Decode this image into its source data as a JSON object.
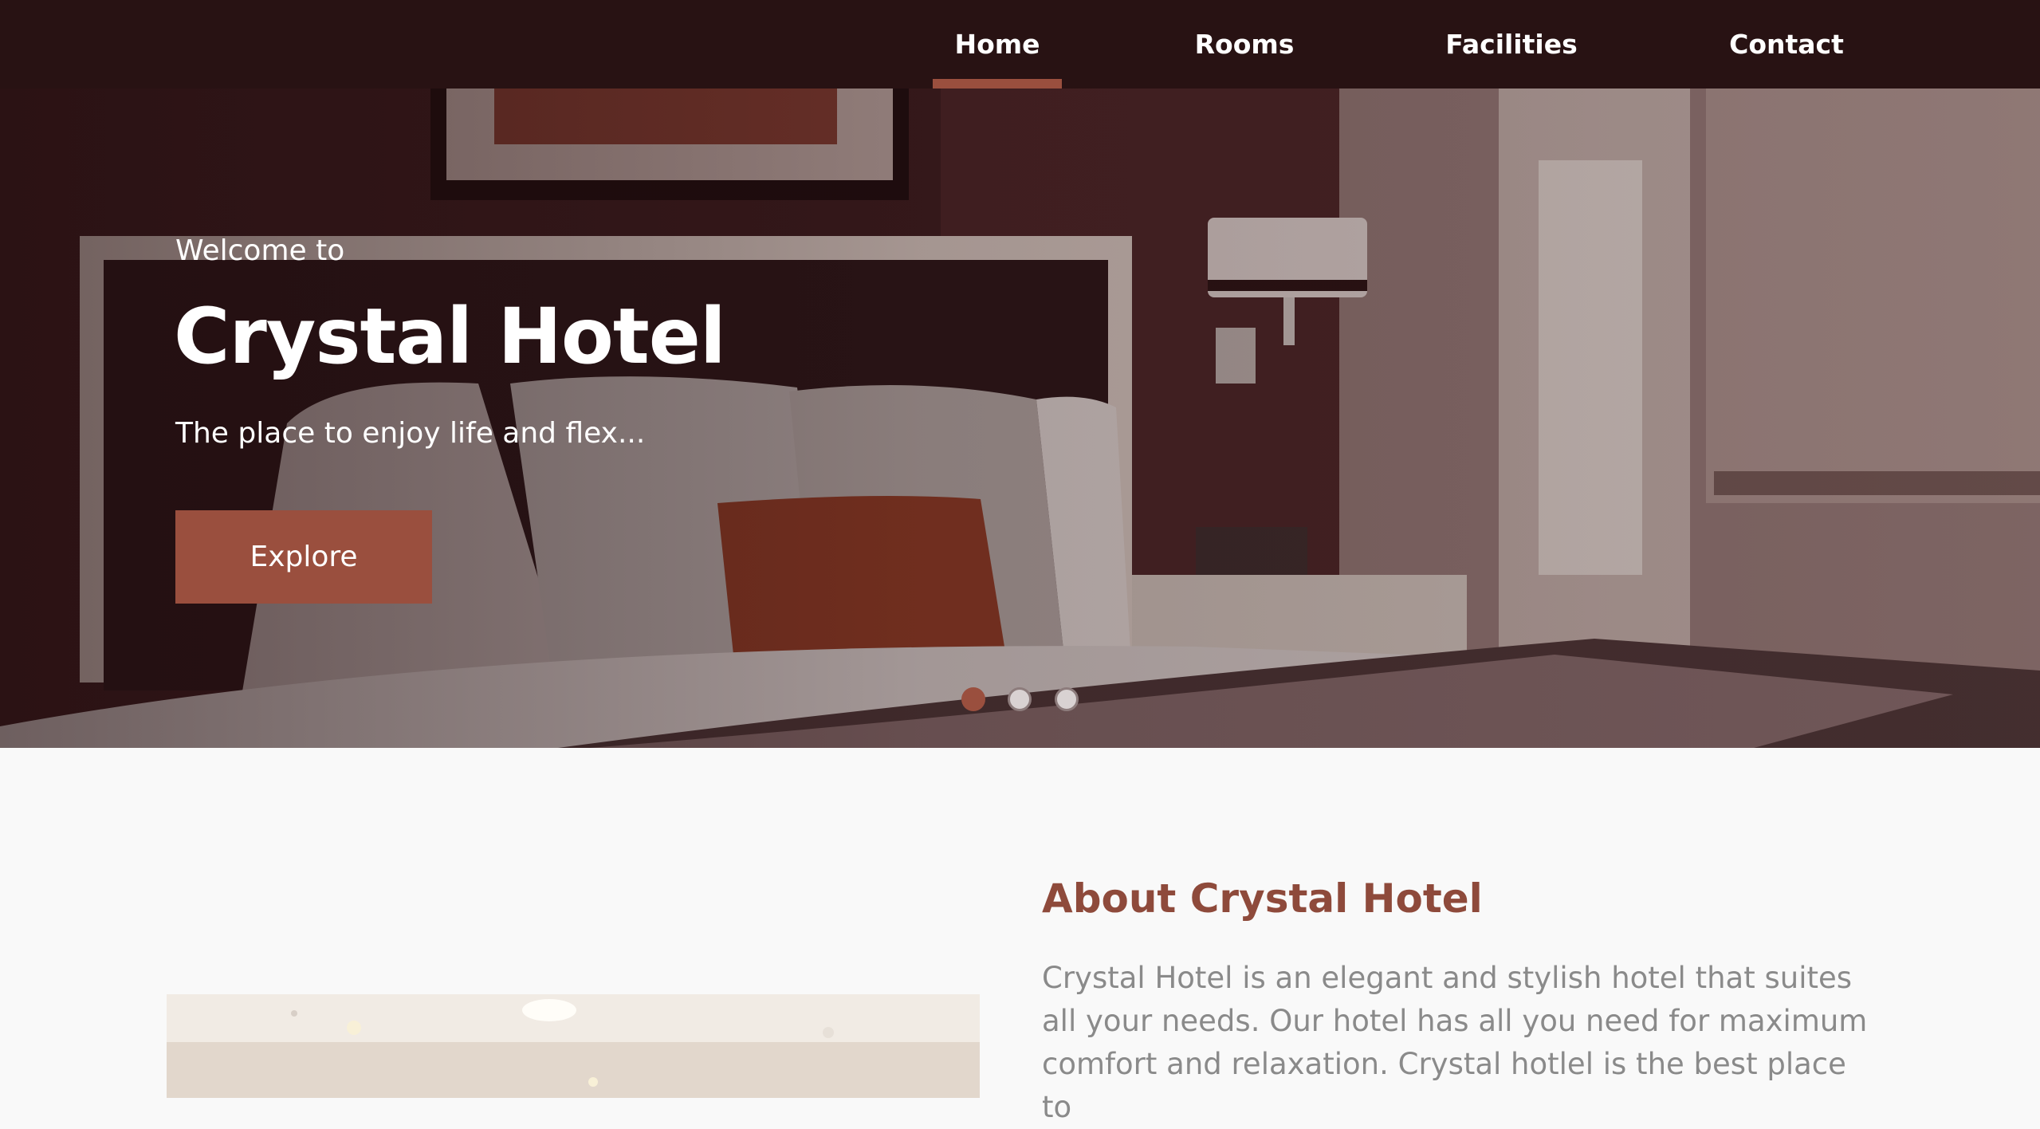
{
  "nav": {
    "items": [
      {
        "label": "Home",
        "active": true
      },
      {
        "label": "Rooms",
        "active": false
      },
      {
        "label": "Facilities",
        "active": false
      },
      {
        "label": "Contact",
        "active": false
      }
    ]
  },
  "hero": {
    "welcome": "Welcome to",
    "title": "Crystal Hotel",
    "tagline": "The place to enjoy life and flex...",
    "button_label": "Explore",
    "slides_count": 3,
    "active_slide": 1
  },
  "about": {
    "title": "About Crystal Hotel",
    "text": "Crystal Hotel is an elegant and stylish hotel that suites all your needs. Our hotel has all you need for maximum comfort and relaxation. Crystal hotlel is the best place to"
  },
  "colors": {
    "nav_bg": "#281213",
    "accent": "#9a4f3e",
    "about_title": "#8e4a3b",
    "about_text": "#8a8a8a",
    "page_bg": "#f9f9f9"
  }
}
